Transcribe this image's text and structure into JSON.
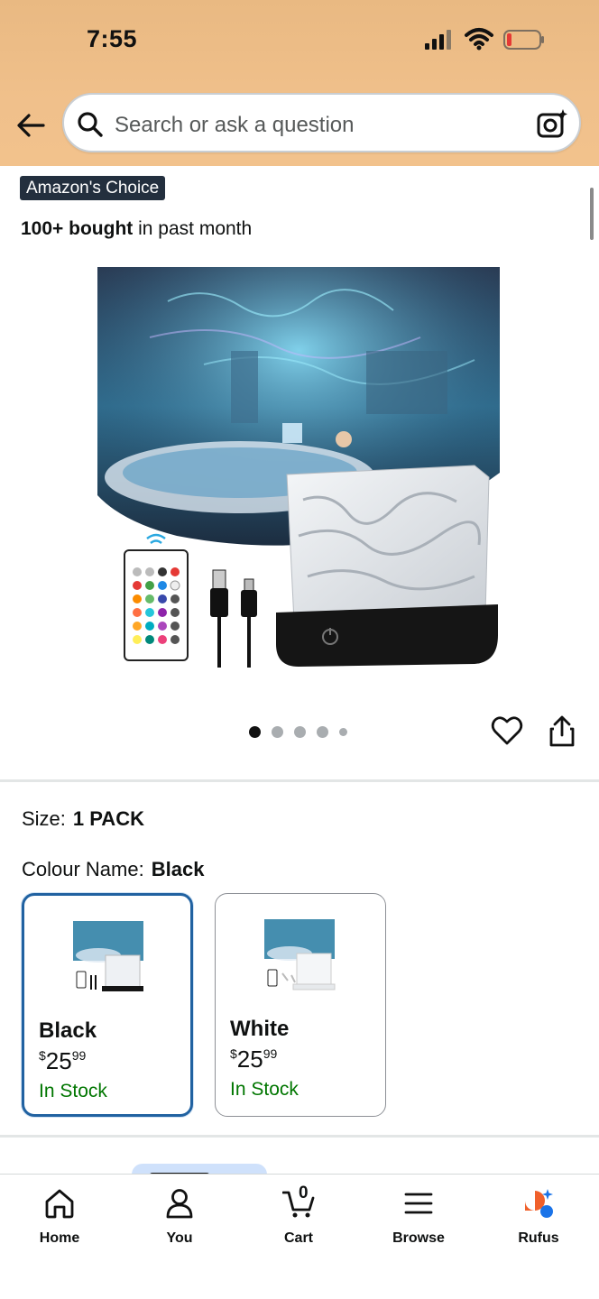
{
  "status_bar": {
    "time": "7:55"
  },
  "search": {
    "placeholder": "Search or ask a question"
  },
  "product": {
    "badge": "Amazon's Choice",
    "bought_count": "100+ bought",
    "bought_suffix": " in past month",
    "image_count": 5,
    "active_image": 1
  },
  "options": {
    "size_label": "Size:",
    "size_value": "1 PACK",
    "colour_label": "Colour Name:",
    "colour_value": "Black",
    "swatches": [
      {
        "name": "Black",
        "currency": "$",
        "price_whole": "25",
        "price_fraction": "99",
        "stock": "In Stock",
        "selected": true
      },
      {
        "name": "White",
        "currency": "$",
        "price_whole": "25",
        "price_fraction": "99",
        "stock": "In Stock",
        "selected": false
      }
    ]
  },
  "nav": {
    "items": [
      {
        "label": "Home",
        "icon": "home-icon"
      },
      {
        "label": "You",
        "icon": "person-icon"
      },
      {
        "label": "Cart",
        "icon": "cart-icon",
        "count": "0"
      },
      {
        "label": "Browse",
        "icon": "menu-icon"
      },
      {
        "label": "Rufus",
        "icon": "rufus-icon"
      }
    ]
  },
  "colors": {
    "accent_blue": "#2162a1",
    "in_stock": "#007600",
    "header_orange": "#f0c08b",
    "badge_bg": "#232f3e"
  }
}
